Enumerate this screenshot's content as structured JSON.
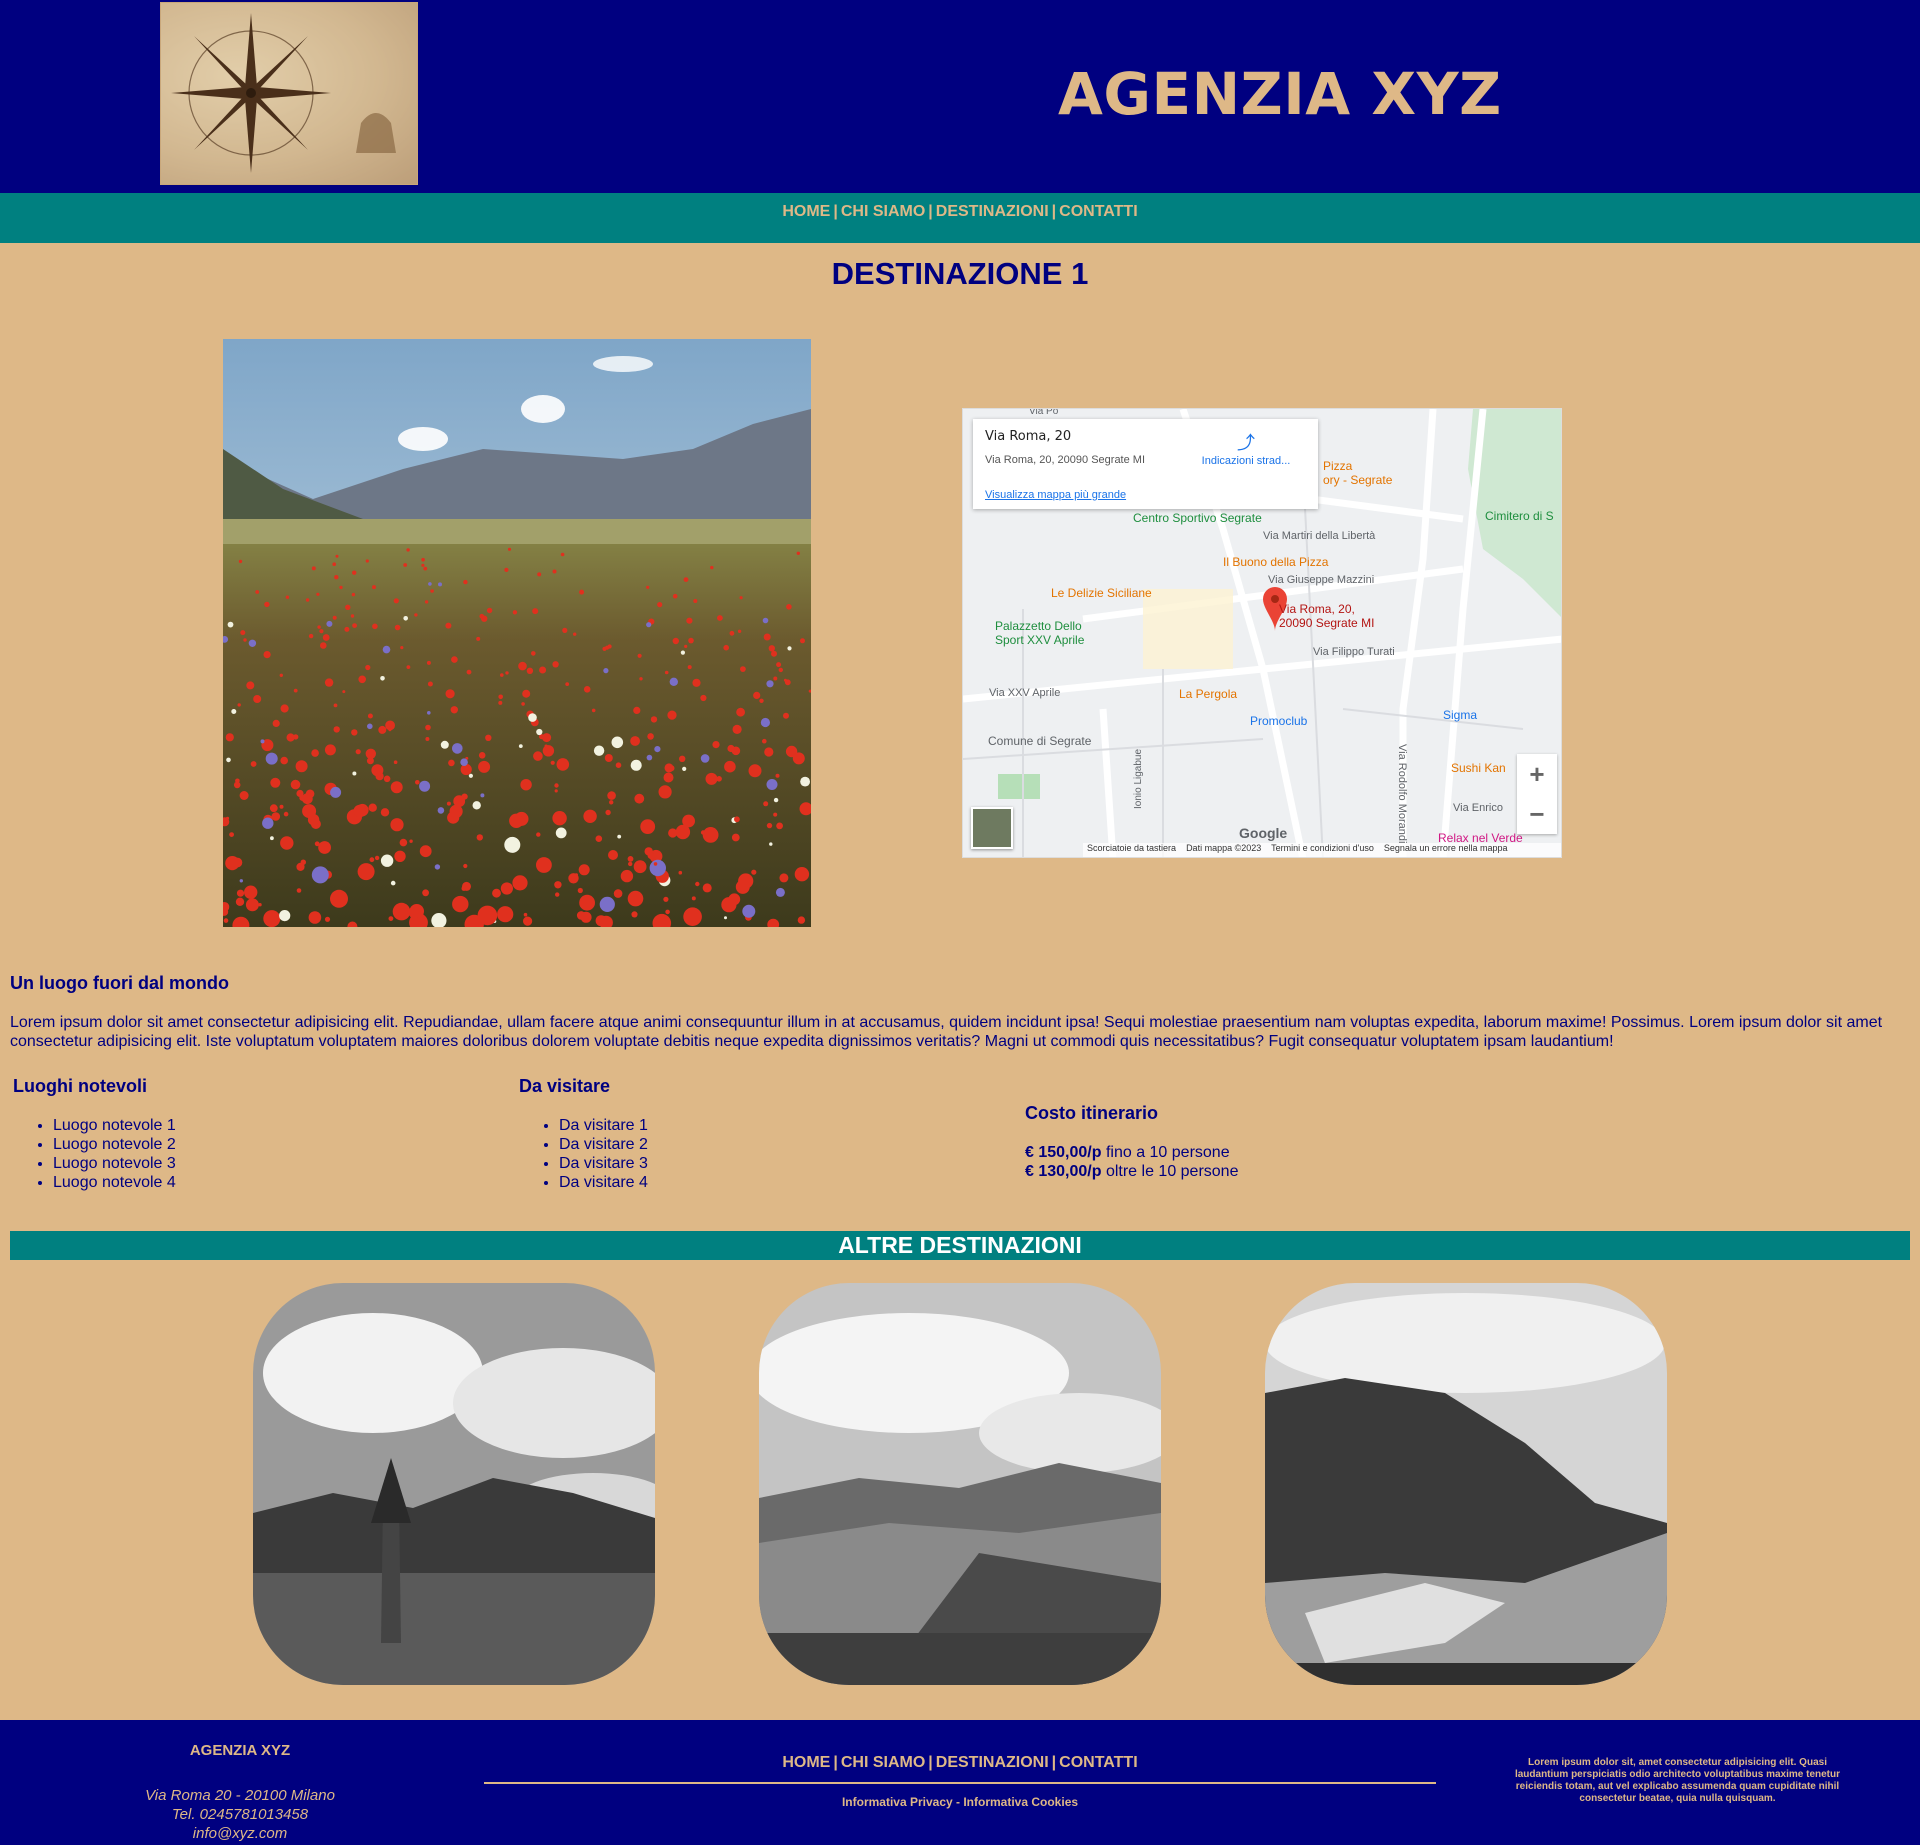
{
  "colors": {
    "navy": "#000080",
    "teal": "#008080",
    "tan": "#deb887"
  },
  "header": {
    "title": "AGENZIA XYZ",
    "logo": "compass-rose-map-logo"
  },
  "nav": {
    "items": [
      "HOME",
      "CHI SIAMO",
      "DESTINAZIONI",
      "CONTATTI"
    ]
  },
  "page": {
    "title": "DESTINAZIONE 1"
  },
  "map": {
    "place_name": "Via Roma, 20",
    "place_address": "Via Roma, 20, 20090 Segrate MI",
    "directions": "Indicazioni strad...",
    "bigger_map": "Visualizza mappa più grande",
    "pin_label_1": "Via Roma, 20,",
    "pin_label_2": "20090 Segrate MI",
    "labels": {
      "centro": "Centro Sportivo Segrate",
      "martiri": "Via Martiri della Libertà",
      "buono": "Il Buono della Pizza",
      "mazzini": "Via Giuseppe Mazzini",
      "delizie": "Le Delizie Siciliane",
      "palazzetto1": "Palazzetto Dello",
      "palazzetto2": "Sport XXV Aprile",
      "turati": "Via Filippo Turati",
      "aprile": "Via XXV Aprile",
      "pergola": "La Pergola",
      "promoclub": "Promoclub",
      "sigma": "Sigma",
      "comune": "Comune di Segrate",
      "sushi": "Sushi Kan",
      "enrico": "Via Enrico",
      "relax": "Relax nel Verde",
      "cimitero": "Cimitero di S",
      "pizza1": "Pizza",
      "pizza2": "ory - Segrate",
      "via_po": "Via Po",
      "ligabue": "Ionio Ligabue",
      "morandi": "Via Rodolfo Morandi"
    },
    "google": "Google",
    "footer_items": [
      "Scorciatoie da tastiera",
      "Dati mappa ©2023",
      "Termini e condizioni d'uso",
      "Segnala un errore nella mappa"
    ],
    "zoom_in": "+",
    "zoom_out": "−"
  },
  "content": {
    "subtitle": "Un luogo fuori dal mondo",
    "lorem": "Lorem ipsum dolor sit amet consectetur adipisicing elit. Repudiandae, ullam facere atque animi consequuntur illum in at accusamus, quidem incidunt ipsa! Sequi molestiae praesentium nam voluptas expedita, laborum maxime! Possimus. Lorem ipsum dolor sit amet consectetur adipisicing elit. Iste voluptatum voluptatem maiores doloribus dolorem voluptate debitis neque expedita dignissimos veritatis? Magni ut commodi quis necessitatibus? Fugit consequatur voluptatem ipsam laudantium!",
    "luoghi": {
      "title": "Luoghi notevoli",
      "items": [
        "Luogo notevole 1",
        "Luogo notevole 2",
        "Luogo notevole 3",
        "Luogo notevole 4"
      ]
    },
    "visitare": {
      "title": "Da visitare",
      "items": [
        "Da visitare 1",
        "Da visitare 2",
        "Da visitare 3",
        "Da visitare 4"
      ]
    },
    "costo": {
      "title": "Costo itinerario",
      "price1": "€ 150,00/p",
      "desc1": " fino a 10 persone",
      "price2": "€ 130,00/p",
      "desc2": " oltre le 10 persone"
    },
    "altre": "ALTRE DESTINAZIONI"
  },
  "footer": {
    "brand": "AGENZIA XYZ",
    "address": "Via Roma 20 - 20100 Milano",
    "tel": "Tel. 0245781013458",
    "email": "info@xyz.com",
    "nav": [
      "HOME",
      "CHI SIAMO",
      "DESTINAZIONI",
      "CONTATTI"
    ],
    "privacy": "Informativa Privacy",
    "legal_sep": " - ",
    "cookies": "Informativa Cookies",
    "blurb": "Lorem ipsum dolor sit, amet consectetur adipisicing elit. Quasi laudantium perspiciatis odio architecto voluptatibus maxime tenetur reiciendis totam, aut vel explicabo assumenda quam cupiditate nihil consectetur beatae, quia nulla quisquam."
  }
}
